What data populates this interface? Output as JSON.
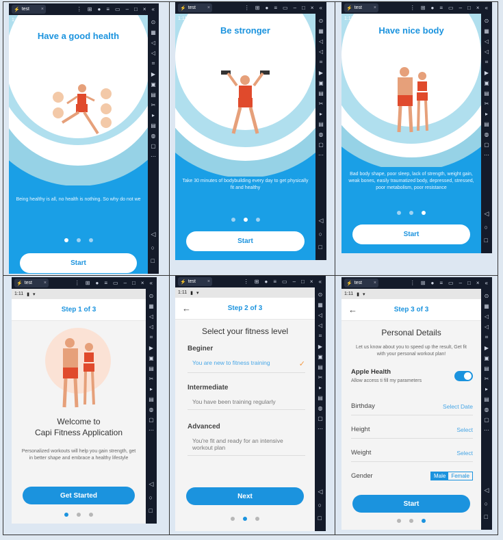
{
  "emulator": {
    "tab_label": "test",
    "status_time": "1:11"
  },
  "onboarding": [
    {
      "title": "Have a good health",
      "text": "Being healthy is all, no health is nothing. So why do not we",
      "button": "Start",
      "active_dot": 0
    },
    {
      "title": "Be stronger",
      "text": "Take 30 minutes of bodybuilding every day to get physically fit and healthy",
      "button": "Start",
      "active_dot": 1
    },
    {
      "title": "Have nice body",
      "text": "Bad body shape, poor sleep, lack of strength, weight gain, weak bones, easily traumatized body, depressed, stressed, poor metabolism, poor resistance",
      "button": "Start",
      "active_dot": 2
    }
  ],
  "step1": {
    "header": "Step 1 of 3",
    "title_line1": "Welcome to",
    "title_line2": "Capi Fitness Application",
    "text": "Personalized workouts will help you gain strength, get in better shape and embrace a healthy lifestyle",
    "button": "Get Started"
  },
  "step2": {
    "header": "Step 2 of 3",
    "title": "Select your fitness level",
    "button": "Next",
    "levels": [
      {
        "name": "Beginer",
        "desc": "You are new to fitness training",
        "selected": true
      },
      {
        "name": "Intermediate",
        "desc": "You have been training regularly",
        "selected": false
      },
      {
        "name": "Advanced",
        "desc": "You're fit and ready for an intensive workout plan",
        "selected": false
      }
    ]
  },
  "step3": {
    "header": "Step 3 of 3",
    "title": "Personal Details",
    "text": "Let us know about you to speed up the result, Get fit with your personal workout plan!",
    "apple_health": "Apple Health",
    "apple_health_sub": "Allow access ti fill my parameters",
    "apple_health_on": true,
    "birthday": "Birthday",
    "birthday_value": "Select Date",
    "height": "Height",
    "height_value": "Select",
    "weight": "Weight",
    "weight_value": "Select",
    "gender": "Gender",
    "gender_male": "Male",
    "gender_female": "Female",
    "gender_selected": "Male",
    "button": "Start"
  },
  "colors": {
    "accent": "#1b93de",
    "light_blue": "#96d2e6",
    "check": "#f39a45"
  }
}
